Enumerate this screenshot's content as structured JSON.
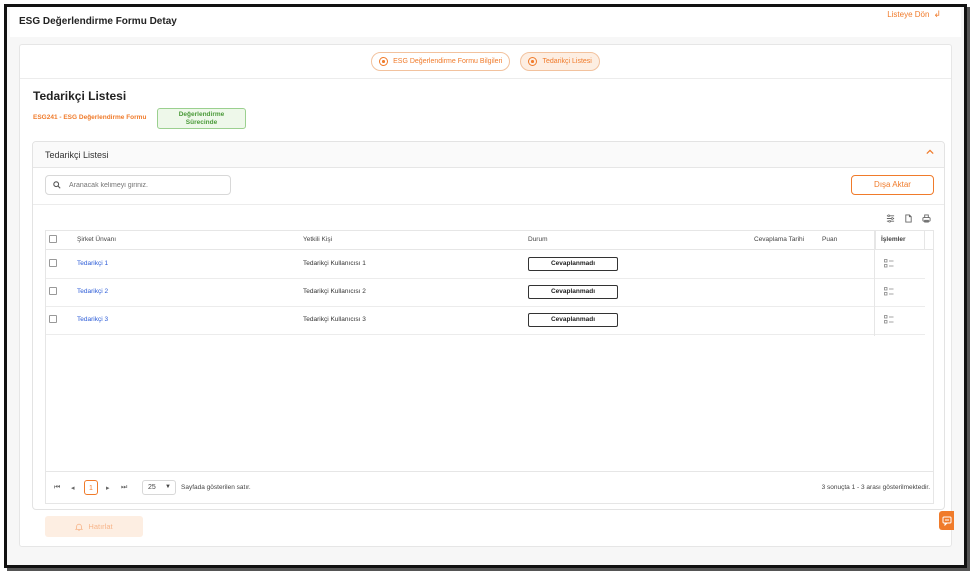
{
  "header": {
    "title": "ESG Değerlendirme Formu Detay",
    "back_label": "Listeye Dön"
  },
  "tabs": [
    {
      "label": "ESG Değerlendirme Formu Bilgileri",
      "active": false
    },
    {
      "label": "Tedarikçi Listesi",
      "active": true
    }
  ],
  "section": {
    "title": "Tedarikçi Listesi",
    "form_ref": "ESG241 - ESG Değerlendirme Formu",
    "status_line1": "Değerlendirme",
    "status_line2": "Sürecinde"
  },
  "panel": {
    "title": "Tedarikçi Listesi",
    "search_placeholder": "Aranacak kelimeyi giriniz.",
    "export_label": "Dışa Aktar"
  },
  "table": {
    "columns": {
      "company": "Şirket Ünvanı",
      "contact": "Yetkili Kişi",
      "status": "Durum",
      "reply_date": "Cevaplama Tarihi",
      "score": "Puan",
      "actions": "İşlemler"
    },
    "rows": [
      {
        "company": "Tedarikçi 1",
        "contact": "Tedarikçi Kullanıcısı 1",
        "status": "Cevaplanmadı"
      },
      {
        "company": "Tedarikçi 2",
        "contact": "Tedarikçi Kullanıcısı 2",
        "status": "Cevaplanmadı"
      },
      {
        "company": "Tedarikçi 3",
        "contact": "Tedarikçi Kullanıcısı 3",
        "status": "Cevaplanmadı"
      }
    ]
  },
  "pager": {
    "current_page": "1",
    "page_size": "25",
    "page_size_label": "Sayfada gösterilen satır.",
    "info": "3 sonuçta 1 - 3 arası gösterilmektedir."
  },
  "remind_label": "Hatırlat",
  "colors": {
    "accent": "#f07b2b",
    "link": "#2b5bd7",
    "status_green": "#4b9a3a"
  }
}
